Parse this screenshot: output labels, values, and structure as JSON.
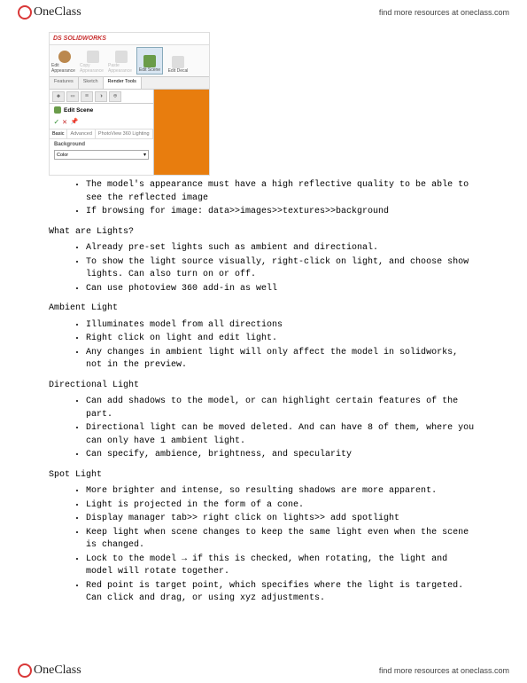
{
  "brand": {
    "name": "OneClass",
    "link_text": "find more resources at oneclass.com"
  },
  "screenshot": {
    "app_title": "DS SOLIDWORKS",
    "toolbar": [
      {
        "label": "Edit Appearance"
      },
      {
        "label": "Copy Appearance"
      },
      {
        "label": "Paste Appearance"
      },
      {
        "label": "Edit Scene"
      },
      {
        "label": "Edit Decal"
      }
    ],
    "tabs": [
      {
        "label": "Features"
      },
      {
        "label": "Sketch"
      },
      {
        "label": "Render Tools"
      }
    ],
    "panel_title": "Edit Scene",
    "subtabs": [
      {
        "label": "Basic"
      },
      {
        "label": "Advanced"
      },
      {
        "label": "PhotoView 360 Lighting"
      }
    ],
    "section": "Background",
    "dropdown_value": "Color"
  },
  "doc": {
    "intro": [
      "The model's appearance must have a high reflective quality to be able to see the reflected image",
      "If browsing for image: data>>images>>textures>>background"
    ],
    "h_lights": "What are Lights?",
    "lights": [
      "Already pre-set lights such as ambient and directional.",
      "To show the light source visually, right-click on light, and choose show lights. Can also turn on or off.",
      "Can use photoview 360 add-in as well"
    ],
    "h_ambient": "Ambient Light",
    "ambient": [
      "Illuminates model from all directions",
      "Right click on light and edit light.",
      "Any changes in ambient light will only affect the model in solidworks, not in the preview."
    ],
    "h_directional": "Directional Light",
    "directional": [
      "Can add shadows to the model, or can highlight certain features of the part.",
      "Directional light can be moved deleted. And can have 8 of them, where you can only have 1 ambient light.",
      "Can specify, ambience, brightness, and specularity"
    ],
    "h_spot": "Spot Light",
    "spot": [
      "More brighter and intense, so resulting shadows are more apparent.",
      "Light is projected in the form of a cone.",
      "Display manager tab>> right click on lights>> add spotlight",
      "Keep light when scene changes to keep the same light even when the scene is changed.",
      "Lock to the model → if this is checked, when rotating, the light and model will rotate together.",
      "Red point is target point, which specifies where the light is targeted. Can click and drag, or using xyz adjustments."
    ]
  }
}
